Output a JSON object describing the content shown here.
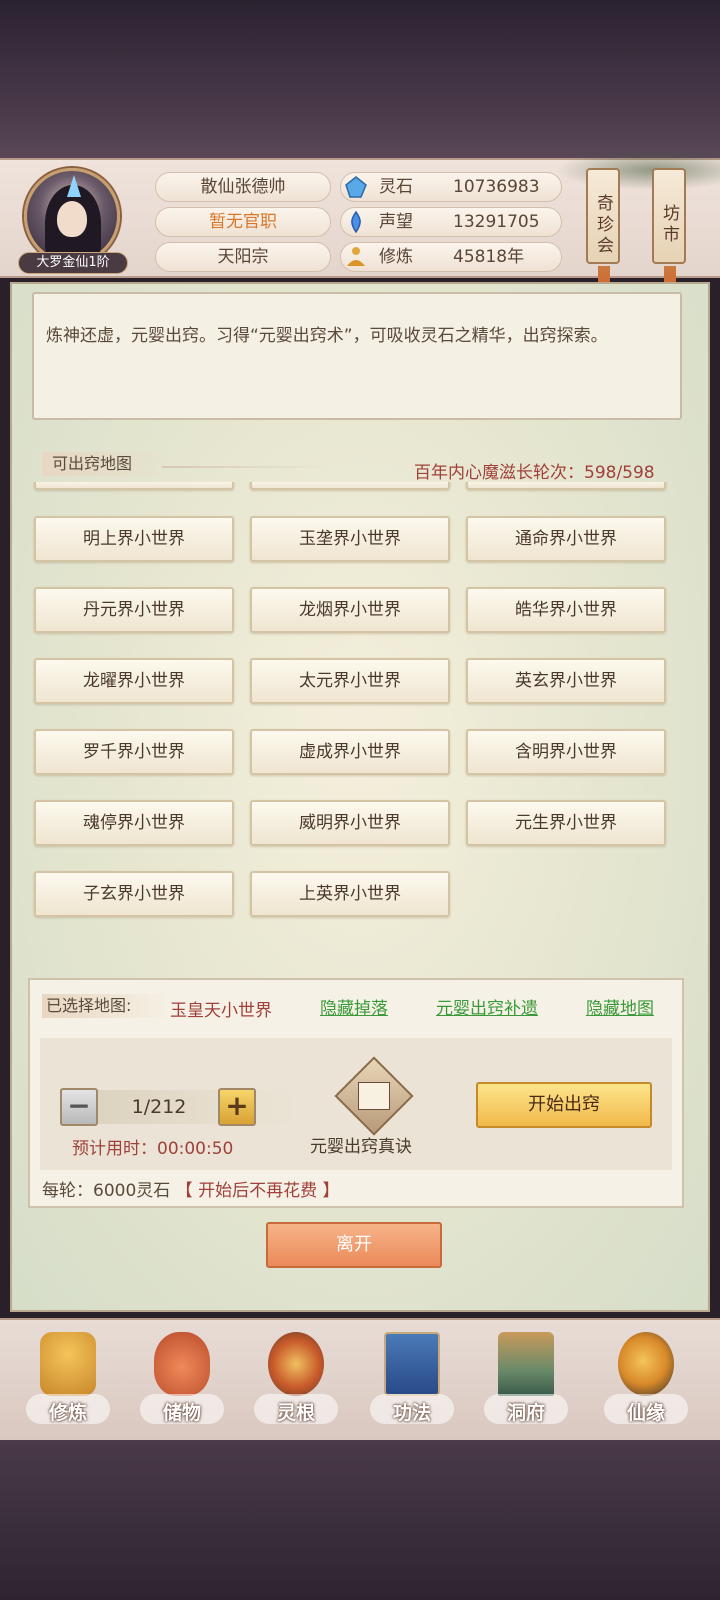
{
  "player": {
    "name": "散仙张德帅",
    "official_title": "暂无官职",
    "sect": "天阳宗",
    "rank": "大罗金仙1阶"
  },
  "stats": [
    {
      "label": "灵石",
      "value": "10736983",
      "icon": "spirit-stone-icon",
      "color": "#4a90d9"
    },
    {
      "label": "声望",
      "value": "13291705",
      "icon": "reputation-icon",
      "color": "#3a78c8"
    },
    {
      "label": "修炼",
      "value": "45818年",
      "icon": "meditation-icon",
      "color": "#d9a234"
    }
  ],
  "side_buttons": [
    {
      "label": "奇珍会"
    },
    {
      "label": "坊市"
    }
  ],
  "intro": "炼神还虚，元婴出窍。习得“元婴出窍术”，可吸收灵石之精华，出窍探索。",
  "map_section": {
    "title": "可出窍地图",
    "demon_count": "百年内心魔滋长轮次：598/598"
  },
  "maps": [
    "明上界小世界",
    "玉垄界小世界",
    "通命界小世界",
    "丹元界小世界",
    "龙烟界小世界",
    "皓华界小世界",
    "龙曜界小世界",
    "太元界小世界",
    "英玄界小世界",
    "罗千界小世界",
    "虚成界小世界",
    "含明界小世界",
    "魂停界小世界",
    "威明界小世界",
    "元生界小世界",
    "子玄界小世界",
    "上英界小世界"
  ],
  "selection": {
    "label": "已选择地图:",
    "map": "玉皇天小世界",
    "links": [
      "隐藏掉落",
      "元婴出窍补遗",
      "隐藏地图"
    ],
    "stepper_value": "1/212",
    "minus": "−",
    "plus": "+",
    "eta": "预计用时：00:00:50",
    "book_label": "元婴出窍真诀",
    "start_label": "开始出窍",
    "cost": "每轮：6000灵石",
    "cost_note": "【 开始后不再花费 】"
  },
  "leave_label": "离开",
  "nav": [
    {
      "label": "修炼",
      "icon": "cultivation-icon",
      "color": "#d9a234"
    },
    {
      "label": "储物",
      "icon": "storage-bag-icon",
      "color": "#d95a3a"
    },
    {
      "label": "灵根",
      "icon": "spirit-root-icon",
      "color": "#c86a2a"
    },
    {
      "label": "功法",
      "icon": "technique-book-icon",
      "color": "#3a6aa8"
    },
    {
      "label": "洞府",
      "icon": "cave-dwelling-icon",
      "color": "#8a5a3a"
    },
    {
      "label": "仙缘",
      "icon": "immortal-fate-icon",
      "color": "#d98a2a"
    }
  ]
}
